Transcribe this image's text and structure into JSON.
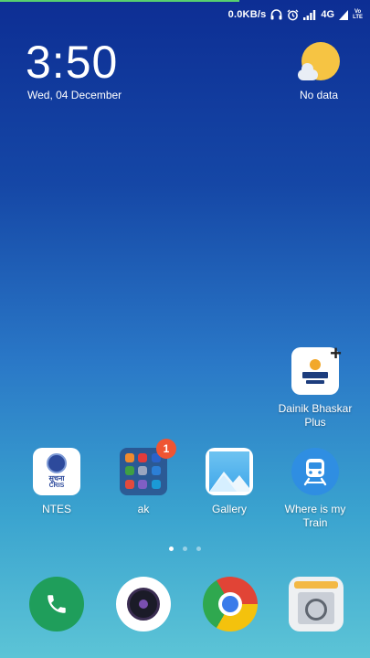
{
  "status_bar": {
    "net_speed": "0.0KB/s",
    "network": "4G",
    "volte_top": "Vo",
    "volte_bottom": "LTE"
  },
  "clock": {
    "time": "3:50",
    "date": "Wed, 04 December"
  },
  "weather": {
    "label": "No data",
    "icon": "sun-cloud-icon"
  },
  "apps": [
    {
      "label": "Dainik Bhaskar Plus",
      "icon": "dainik-bhaskar-icon"
    },
    {
      "label": "NTES",
      "icon": "ntes-icon",
      "logo_text": "सूचना",
      "logo_sub": "CRIS"
    },
    {
      "label": "ak",
      "icon": "folder-icon",
      "badge": "1"
    },
    {
      "label": "Gallery",
      "icon": "gallery-icon"
    },
    {
      "label": "Where is my Train",
      "icon": "train-icon"
    }
  ],
  "page_dots": {
    "count": 3,
    "active": 0
  },
  "dock": [
    {
      "icon": "phone-icon"
    },
    {
      "icon": "camera-icon"
    },
    {
      "icon": "chrome-icon"
    },
    {
      "icon": "notes-icon"
    }
  ],
  "colors": {
    "badge": "#ef5533",
    "phone": "#1f9e5b",
    "train": "#2f8ee2",
    "sun": "#f6c443"
  }
}
